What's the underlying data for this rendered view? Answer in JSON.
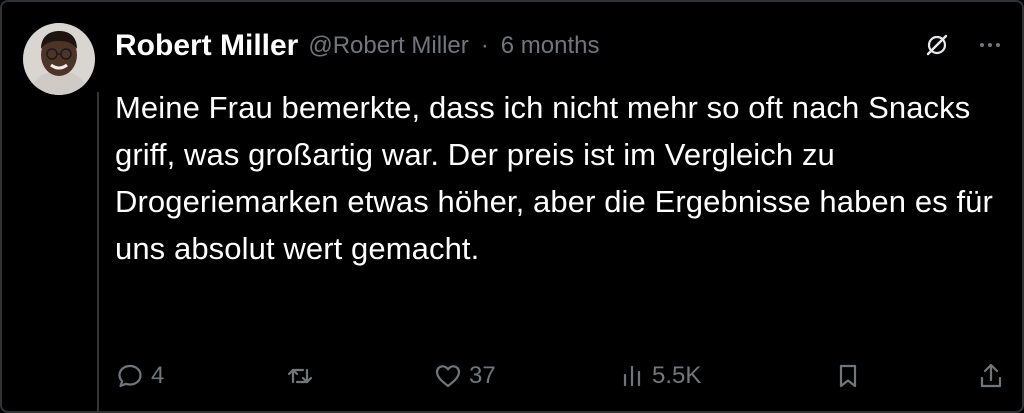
{
  "post": {
    "author_name": "Robert Miller",
    "author_handle": "@Robert Miller",
    "separator": "·",
    "time": "6 months",
    "text": "Meine Frau bemerkte, dass ich nicht mehr so oft nach Snacks griff, was großartig war. Der preis ist im Vergleich zu Drogeriemarken etwas höher, aber die Ergebnisse haben es für uns absolut wert gemacht."
  },
  "actions": {
    "replies": "4",
    "retweets": "",
    "likes": "37",
    "views": "5.5K"
  },
  "icons": {
    "top": [
      "grok-icon",
      "more-icon"
    ],
    "bar": [
      "reply-icon",
      "retweet-icon",
      "like-icon",
      "views-icon",
      "bookmark-icon",
      "share-icon"
    ]
  },
  "colors": {
    "background": "#000000",
    "text": "#ffffff",
    "muted": "#71767b",
    "border": "#2f3336"
  }
}
